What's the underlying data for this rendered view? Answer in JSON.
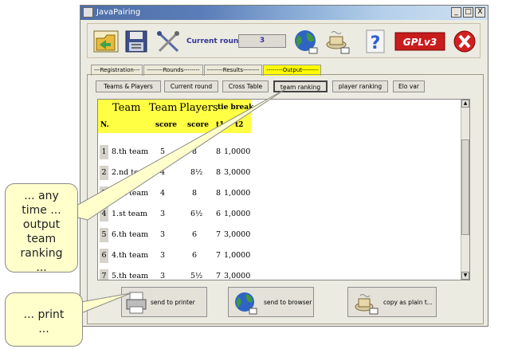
{
  "window": {
    "title": "JavaPairing",
    "controls": [
      "_",
      "□",
      "X"
    ]
  },
  "toolbar": {
    "current_round_label": "Current round",
    "current_round_value": "3",
    "icons": [
      "open-folder-icon",
      "save-disk-icon",
      "tools-icon",
      "globe-icon",
      "tea-icon",
      "help-icon",
      "gpl-icon",
      "exit-icon"
    ],
    "gpl_text": "GPLv3"
  },
  "tabs": [
    {
      "label": "---Registration---",
      "active": false
    },
    {
      "label": "--------Rounds--------",
      "active": false
    },
    {
      "label": "--------Results--------",
      "active": false
    },
    {
      "label": "--------Output--------",
      "active": true
    }
  ],
  "subtabs": [
    "Teams & Players",
    "Current round",
    "Cross Table",
    "team ranking",
    "player ranking",
    "Elo var"
  ],
  "selected_subtab": "team ranking",
  "table": {
    "header_main": [
      "Team",
      "Team",
      "Players",
      "tie break"
    ],
    "header_sub": [
      "N.",
      "score",
      "score",
      "t1",
      "t2"
    ],
    "rows": [
      {
        "n": "1",
        "team": "8.th team",
        "team_score": "5",
        "players_score": "8",
        "t1": "8",
        "t2": "1,0000"
      },
      {
        "n": "2",
        "team": "2.nd team",
        "team_score": "4",
        "players_score": "8½",
        "t1": "8",
        "t2": "3,0000"
      },
      {
        "n": "3",
        "team": "7.th team",
        "team_score": "4",
        "players_score": "8",
        "t1": "8",
        "t2": "1,0000"
      },
      {
        "n": "4",
        "team": "1.st team",
        "team_score": "3",
        "players_score": "6½",
        "t1": "6",
        "t2": "1,0000"
      },
      {
        "n": "5",
        "team": "6.th team",
        "team_score": "3",
        "players_score": "6",
        "t1": "7",
        "t2": "3,0000"
      },
      {
        "n": "6",
        "team": "4.th team",
        "team_score": "3",
        "players_score": "6",
        "t1": "7",
        "t2": "1,0000"
      },
      {
        "n": "7",
        "team": "5.th team",
        "team_score": "3",
        "players_score": "5½",
        "t1": "7",
        "t2": "3,0000"
      }
    ]
  },
  "actions": {
    "printer": "send to printer",
    "browser": "send to browser",
    "copy": "copy as plain t..."
  },
  "callouts": {
    "output_lines": [
      "... any",
      "time ...",
      "output",
      "team",
      "ranking",
      "..."
    ],
    "print_lines": [
      "... print",
      "..."
    ]
  }
}
